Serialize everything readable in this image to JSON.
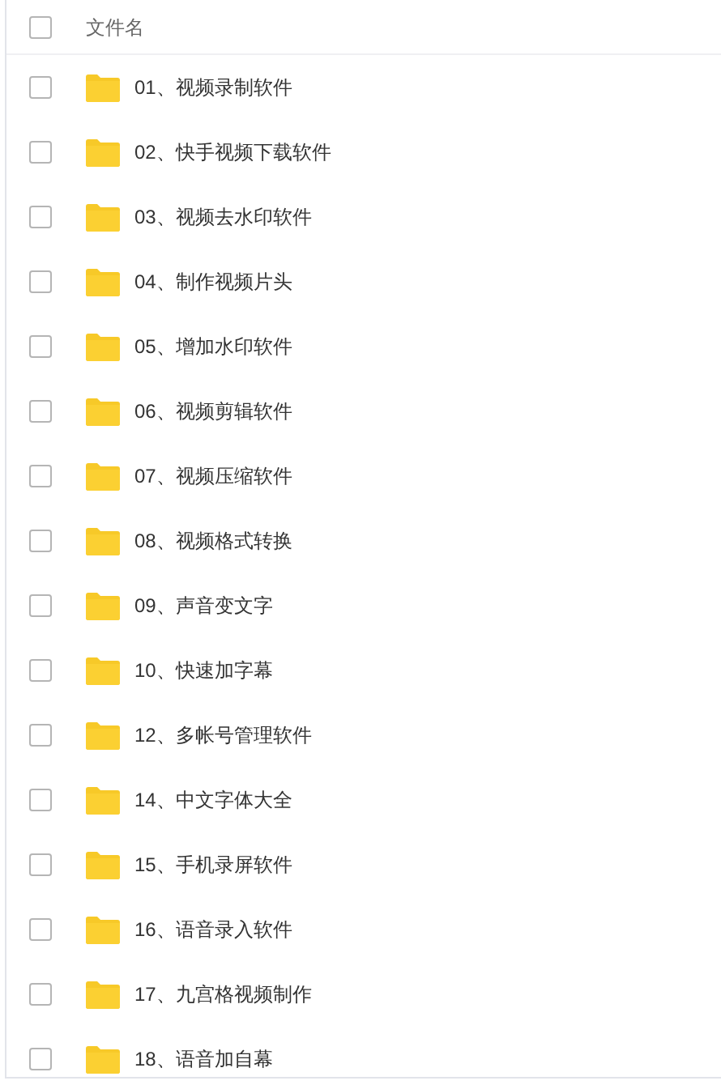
{
  "header": {
    "label": "文件名",
    "checked": false
  },
  "files": [
    {
      "name": "01、视频录制软件",
      "checked": false
    },
    {
      "name": "02、快手视频下载软件",
      "checked": false
    },
    {
      "name": "03、视频去水印软件",
      "checked": false
    },
    {
      "name": "04、制作视频片头",
      "checked": false
    },
    {
      "name": "05、增加水印软件",
      "checked": false
    },
    {
      "name": "06、视频剪辑软件",
      "checked": false
    },
    {
      "name": "07、视频压缩软件",
      "checked": false
    },
    {
      "name": "08、视频格式转换",
      "checked": false
    },
    {
      "name": "09、声音变文字",
      "checked": false
    },
    {
      "name": "10、快速加字幕",
      "checked": false
    },
    {
      "name": "12、多帐号管理软件",
      "checked": false
    },
    {
      "name": "14、中文字体大全",
      "checked": false
    },
    {
      "name": "15、手机录屏软件",
      "checked": false
    },
    {
      "name": "16、语音录入软件",
      "checked": false
    },
    {
      "name": "17、九宫格视频制作",
      "checked": false
    },
    {
      "name": "18、语音加自幕",
      "checked": false
    }
  ]
}
